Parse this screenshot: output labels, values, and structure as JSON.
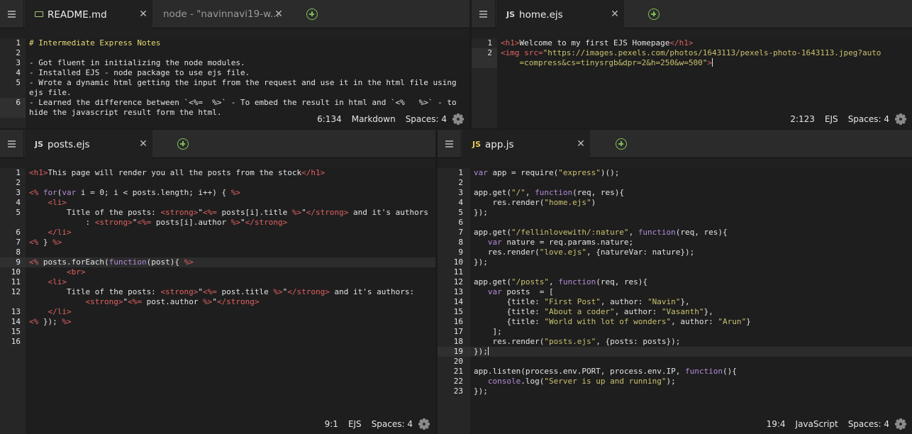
{
  "panes": {
    "readme": {
      "tabs": [
        "README.md",
        "node - \"navinnavi19-w..."
      ],
      "lines": [
        "# Intermediate Express Notes",
        "",
        "- Got fluent in initializing the node modules.",
        "- Installed EJS - node package to use ejs file.",
        "- Wrote a dynamic html getting the input from the request and use it in the html file using",
        "ejs file.",
        "- Learned the difference between `<%=  %>` - To embed the result in html and `<%   %>` - to",
        "hide the javascript result form the html."
      ],
      "line_numbers": [
        "1",
        "2",
        "3",
        "4",
        "5",
        "",
        "6",
        ""
      ],
      "status": {
        "position": "6:134",
        "mode": "Markdown",
        "indent": "Spaces: 4"
      }
    },
    "home": {
      "tab": "home.ejs",
      "icon_label": "JS",
      "line_numbers": [
        "1",
        "2",
        ""
      ],
      "status": {
        "position": "2:123",
        "mode": "EJS",
        "indent": "Spaces: 4"
      }
    },
    "posts": {
      "tab": "posts.ejs",
      "icon_label": "JS",
      "line_numbers": [
        "1",
        "2",
        "3",
        "4",
        "5",
        "",
        "6",
        "7",
        "8",
        "9",
        "10",
        "11",
        "12",
        "",
        "13",
        "14",
        "15",
        "16"
      ],
      "status": {
        "position": "9:1",
        "mode": "EJS",
        "indent": "Spaces: 4"
      }
    },
    "app": {
      "tab": "app.js",
      "icon_label": "JS",
      "line_numbers": [
        "1",
        "2",
        "3",
        "4",
        "5",
        "6",
        "7",
        "8",
        "9",
        "10",
        "11",
        "12",
        "13",
        "14",
        "15",
        "16",
        "17",
        "18",
        "19",
        "20",
        "21",
        "22",
        "23"
      ],
      "status": {
        "position": "19:4",
        "mode": "JavaScript",
        "indent": "Spaces: 4"
      }
    }
  },
  "colors": {
    "tag": "#e06161",
    "string": "#c9c16f",
    "keyword": "#b38bd8",
    "markdown": "#e6db74",
    "add_tab": "#7fbf5a"
  },
  "icons": [
    "menu-icon",
    "markdown-file-icon",
    "close-icon",
    "add-tab-icon",
    "js-file-icon",
    "gear-icon"
  ]
}
